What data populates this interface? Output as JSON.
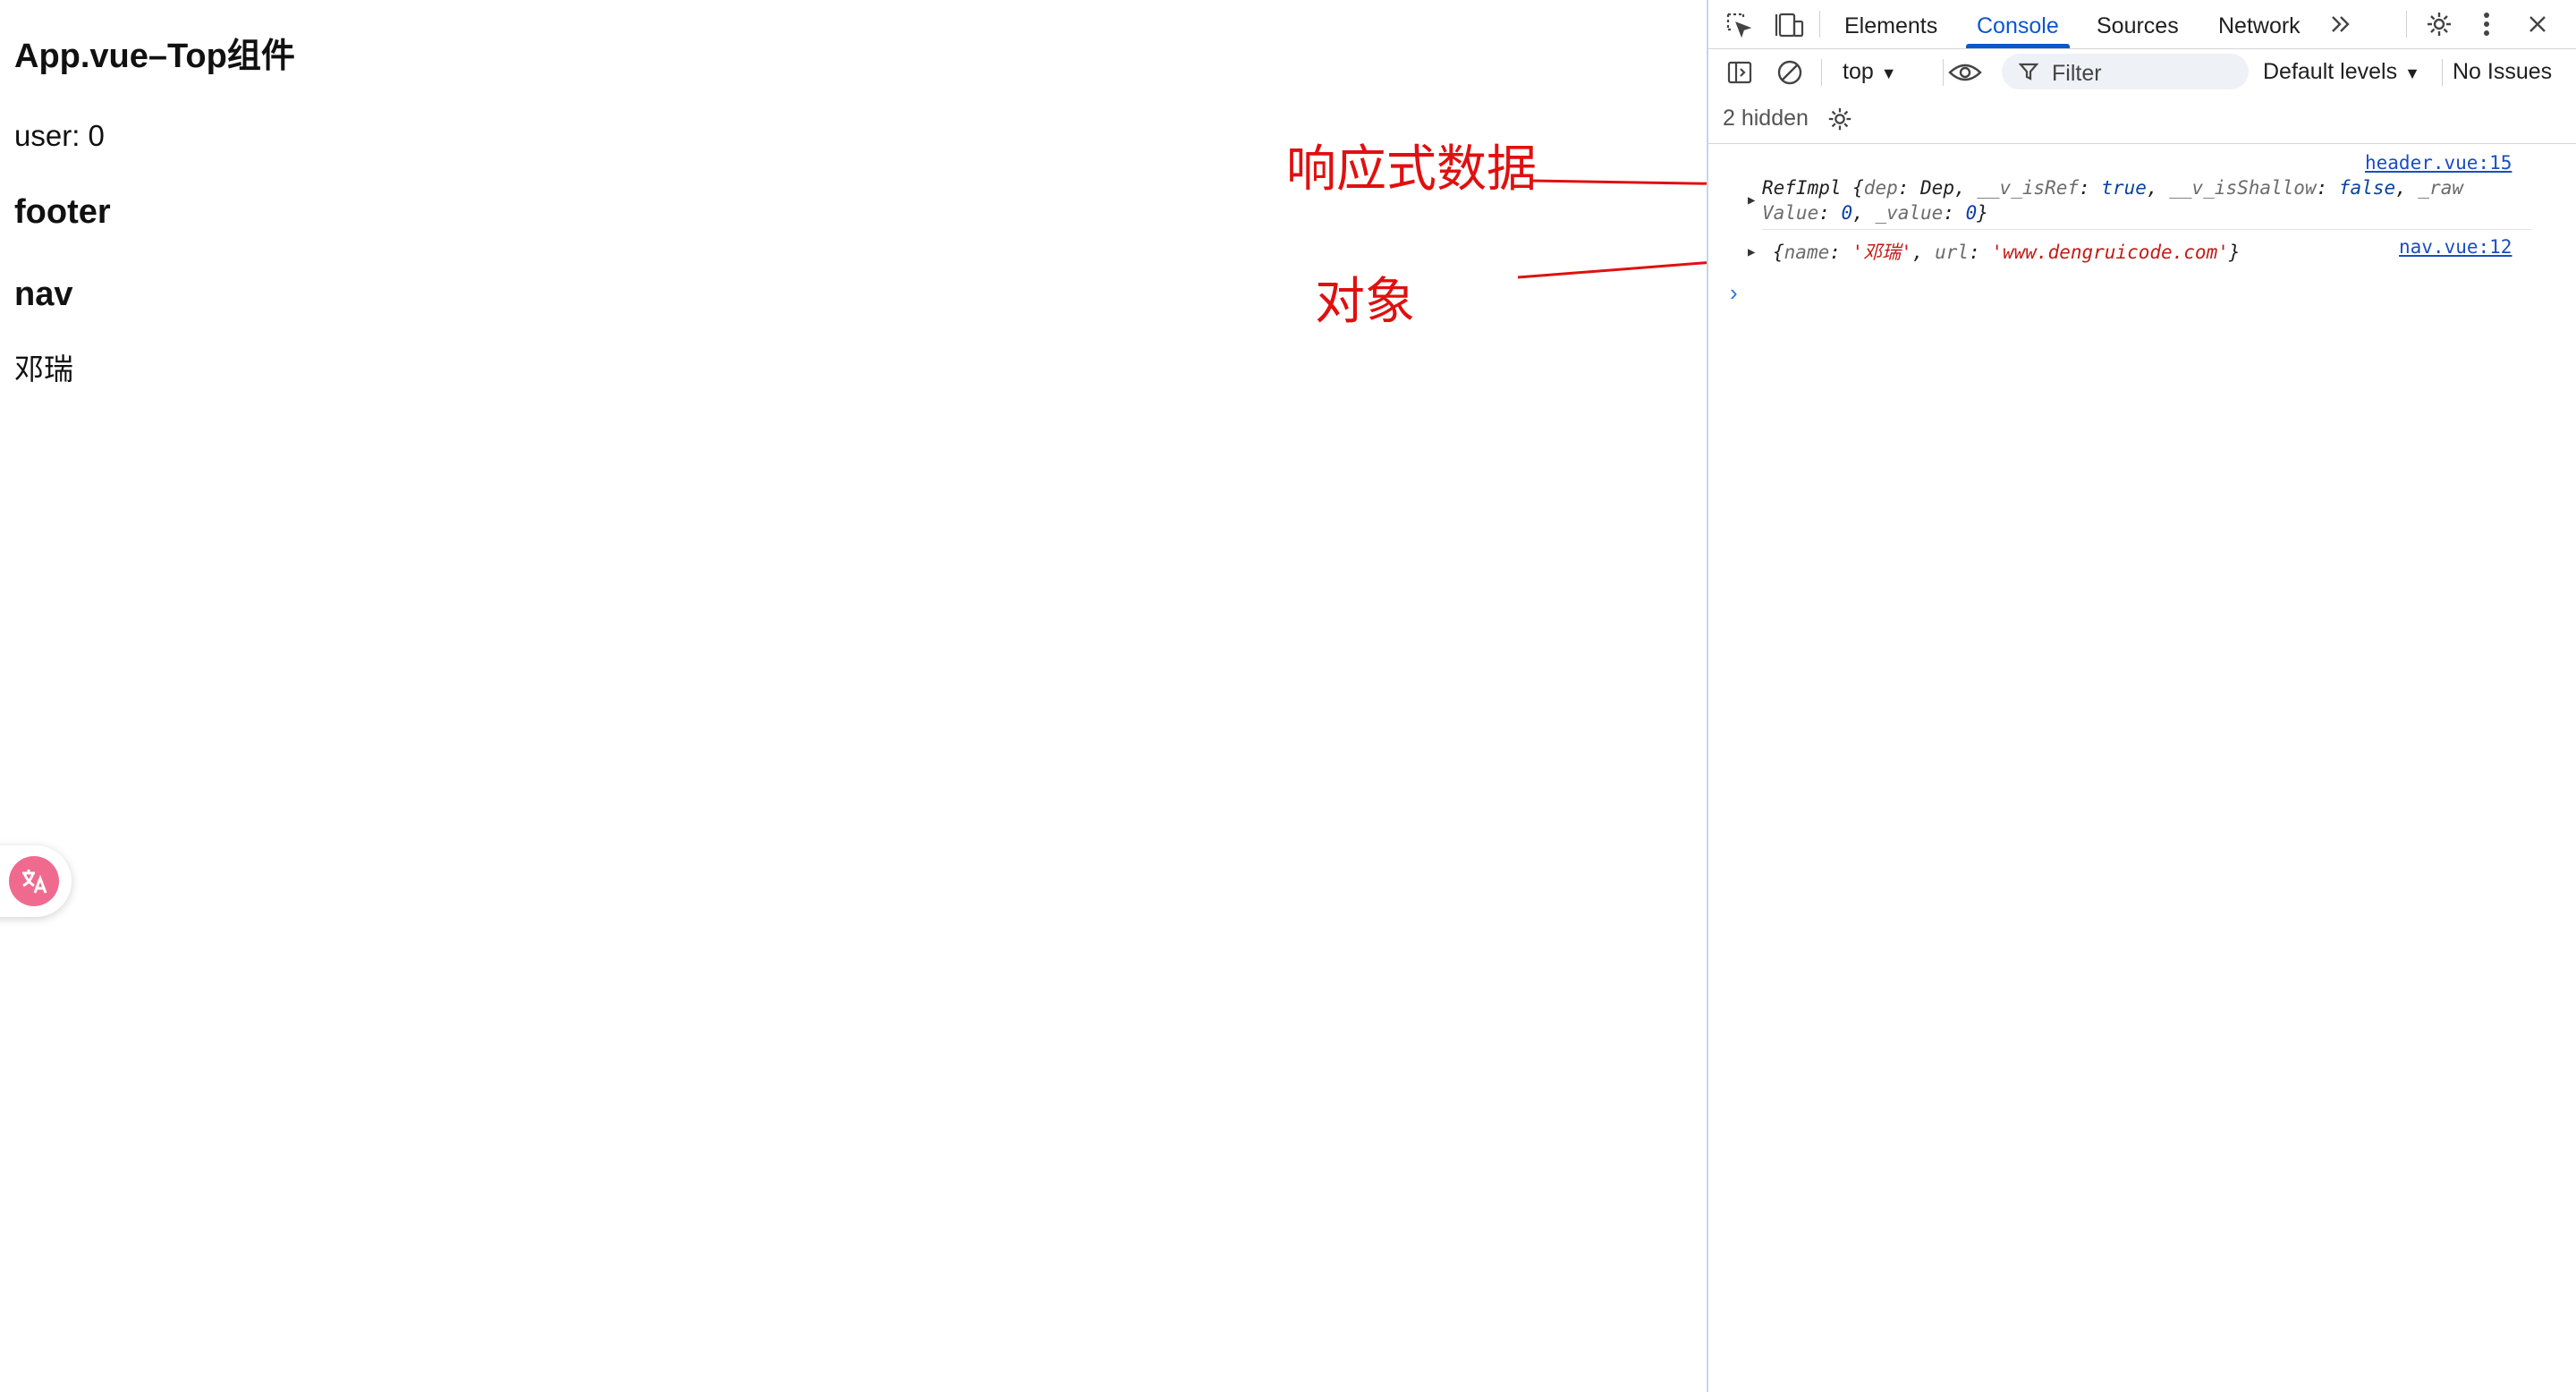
{
  "page": {
    "title": "App.vue–Top组件",
    "user_line": "user: 0",
    "footer_heading": "footer",
    "nav_heading": "nav",
    "name_text": "邓瑞"
  },
  "annotations": {
    "reactive_label": "响应式数据",
    "object_label": "对象",
    "color": "#e01010"
  },
  "translate_widget": {
    "icon": "translate-icon",
    "color": "#f06a8f"
  },
  "devtools": {
    "tabs": [
      {
        "label": "Elements",
        "active": false
      },
      {
        "label": "Console",
        "active": true
      },
      {
        "label": "Sources",
        "active": false
      },
      {
        "label": "Network",
        "active": false
      }
    ],
    "toolbar": {
      "context": "top",
      "filter_placeholder": "Filter",
      "levels": "Default levels",
      "issues": "No Issues"
    },
    "hidden_count": "2 hidden",
    "logs": [
      {
        "source": "header.vue:15",
        "prefix": "RefImpl {",
        "k1": "dep",
        "v1": "Dep",
        "k2": "__v_isRef",
        "v2": "true",
        "k3": "__v_isShallow",
        "v3": "false",
        "k4a": "_raw",
        "k4b": "Value",
        "v4": "0",
        "k5": "_value",
        "v5": "0",
        "suffix": "}"
      },
      {
        "source": "nav.vue:12",
        "k1": "name",
        "v1": "'邓瑞'",
        "k2": "url",
        "v2": "'www.dengruicode.com'"
      }
    ],
    "accent": "#0b57d0"
  }
}
